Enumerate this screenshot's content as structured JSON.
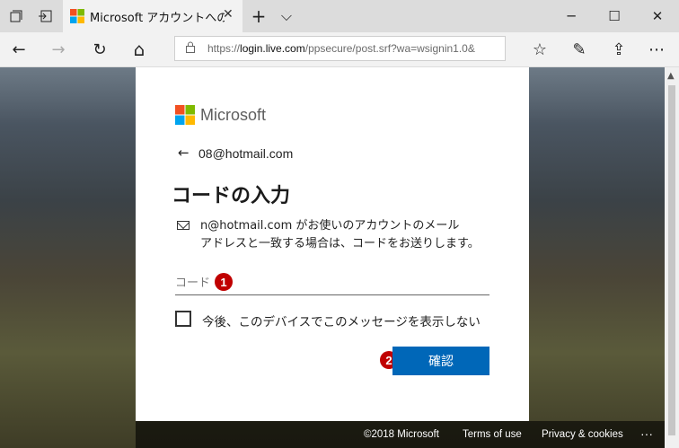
{
  "browser": {
    "tab_title": "Microsoft アカウントへのサ",
    "close_tab": "✕",
    "new_tab": "+",
    "tab_list": "⌵",
    "window_controls": {
      "minimize": "─",
      "maximize": "☐",
      "close": "✕"
    },
    "address": {
      "scheme": "https://",
      "host": "login.live.com",
      "path": "/ppsecure/post.srf?wa=wsignin1.0&"
    },
    "nav_glyphs": {
      "back": "←",
      "forward": "→",
      "refresh": "↻",
      "home": "⌂"
    },
    "toolbar_glyphs": {
      "favorites": "☆",
      "notes": "✎",
      "share": "⇪",
      "more": "⋯"
    }
  },
  "card": {
    "brand": "Microsoft",
    "back_glyph": "←",
    "email_identity": "08@hotmail.com",
    "heading": "コードの入力",
    "description_line1": "n@hotmail.com  がお使いのアカウントのメール",
    "description_line2": "アドレスと一致する場合は、コードをお送りします。",
    "code_placeholder": "コード",
    "checkbox_label": "今後、このデバイスでこのメッセージを表示しない",
    "confirm_label": "確認",
    "badges": [
      "1",
      "2"
    ]
  },
  "footer": {
    "copyright": "©2018 Microsoft",
    "terms": "Terms of use",
    "privacy": "Privacy & cookies",
    "more": "···"
  },
  "colors": {
    "confirm_button": "#0067b8",
    "badge": "#c00000",
    "ms_red": "#f25022",
    "ms_green": "#7fba00",
    "ms_blue": "#00a4ef",
    "ms_yellow": "#ffb900"
  },
  "icons": [
    "tab-manager-icon",
    "set-aside-tabs-icon",
    "microsoft-logo-icon",
    "back-icon",
    "forward-icon",
    "refresh-icon",
    "home-icon",
    "lock-icon",
    "favorites-icon",
    "notes-icon",
    "share-icon",
    "more-icon",
    "mail-icon"
  ]
}
